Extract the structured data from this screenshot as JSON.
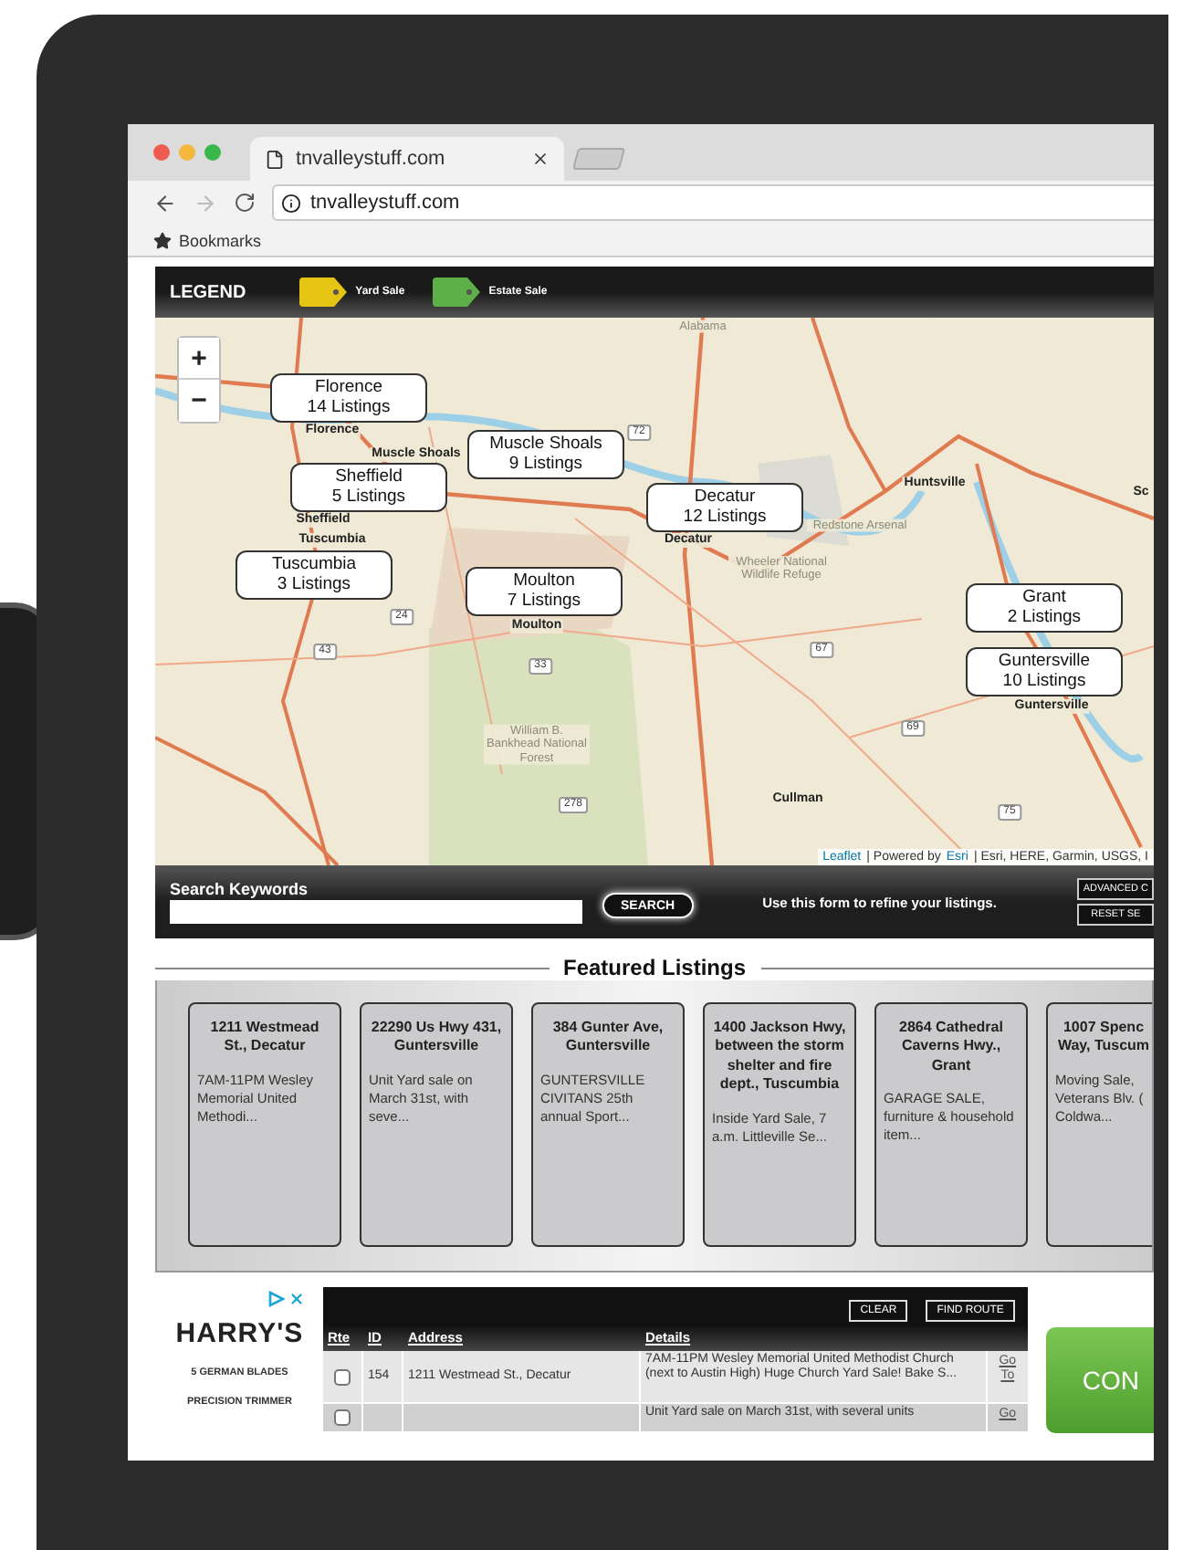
{
  "browser": {
    "tab_title": "tnvalleystuff.com",
    "address": "tnvalleystuff.com",
    "bookmarks": "Bookmarks"
  },
  "legend": {
    "title": "LEGEND",
    "items": [
      {
        "label": "Yard Sale",
        "color": "#e6c414"
      },
      {
        "label": "Estate Sale",
        "color": "#5daf48"
      }
    ]
  },
  "map": {
    "zoom_in": "+",
    "zoom_out": "−",
    "markers": [
      {
        "city": "Florence",
        "count": "14 Listings"
      },
      {
        "city": "Muscle Shoals",
        "count": "9 Listings"
      },
      {
        "city": "Sheffield",
        "count": "5 Listings"
      },
      {
        "city": "Decatur",
        "count": "12 Listings"
      },
      {
        "city": "Tuscumbia",
        "count": "3 Listings"
      },
      {
        "city": "Moulton",
        "count": "7 Listings"
      },
      {
        "city": "Grant",
        "count": "2 Listings"
      },
      {
        "city": "Guntersville",
        "count": "10 Listings"
      }
    ],
    "labels": [
      {
        "text": "Alabama",
        "kind": "area"
      },
      {
        "text": "Florence",
        "kind": "city"
      },
      {
        "text": "Muscle Shoals",
        "kind": "city"
      },
      {
        "text": "Sheffield",
        "kind": "city"
      },
      {
        "text": "Tuscumbia",
        "kind": "city"
      },
      {
        "text": "Decatur",
        "kind": "city"
      },
      {
        "text": "Huntsville",
        "kind": "city"
      },
      {
        "text": "Redstone Arsenal",
        "kind": "area"
      },
      {
        "text": "Wheeler National Wildlife Refuge",
        "kind": "area"
      },
      {
        "text": "Moulton",
        "kind": "city"
      },
      {
        "text": "William B. Bankhead National Forest",
        "kind": "area"
      },
      {
        "text": "Cullman",
        "kind": "city"
      },
      {
        "text": "Guntersville",
        "kind": "city"
      },
      {
        "text": "Sc",
        "kind": "city"
      },
      {
        "text": "72",
        "kind": "shield"
      },
      {
        "text": "24",
        "kind": "shield"
      },
      {
        "text": "43",
        "kind": "shield"
      },
      {
        "text": "33",
        "kind": "shield"
      },
      {
        "text": "67",
        "kind": "shield"
      },
      {
        "text": "69",
        "kind": "shield"
      },
      {
        "text": "278",
        "kind": "shield"
      },
      {
        "text": "75",
        "kind": "shield"
      }
    ],
    "attribution": {
      "leaflet": "Leaflet",
      "powered": "| Powered by",
      "esri": "Esri",
      "sources": "| Esri, HERE, Garmin, USGS, I"
    }
  },
  "search": {
    "label": "Search Keywords",
    "button": "SEARCH",
    "hint": "Use this form to refine your listings.",
    "side_buttons": [
      "ADVANCED C",
      "RESET SE"
    ]
  },
  "featured": {
    "title": "Featured Listings",
    "cards": [
      {
        "address": "1211 Westmead St., Decatur",
        "details": "7AM-11PM Wesley Memorial United Methodi..."
      },
      {
        "address": "22290 Us Hwy 431, Guntersville",
        "details": "Unit Yard sale on March 31st, with seve..."
      },
      {
        "address": "384 Gunter Ave, Guntersville",
        "details": "GUNTERSVILLE CIVITANS 25th annual Sport..."
      },
      {
        "address": "1400 Jackson Hwy, between the storm shelter and fire dept., Tuscumbia",
        "details": "Inside Yard Sale, 7 a.m. Littleville Se..."
      },
      {
        "address": "2864 Cathedral Caverns Hwy., Grant",
        "details": "GARAGE SALE, furniture & household item..."
      },
      {
        "address": "1007 Spenc Way, Tuscum",
        "details": "Moving Sale, Veterans Blv. ( Coldwa..."
      }
    ]
  },
  "ad": {
    "brand": "HARRY'S",
    "tagline": "5 GERMAN BLADES",
    "line": "PRECISION TRIMMER",
    "cta": "CON"
  },
  "route_table": {
    "buttons": [
      "CLEAR",
      "FIND ROUTE"
    ],
    "columns": [
      "Rte",
      "ID",
      "Address",
      "Details"
    ],
    "rows": [
      {
        "checked": false,
        "id": "154",
        "address": "1211 Westmead St., Decatur",
        "details": "7AM-11PM Wesley Memorial United Methodist Church (next to Austin High) Huge Church Yard Sale! Bake S...",
        "link": "Go To"
      },
      {
        "checked": false,
        "details": "Unit Yard sale on March 31st, with several units",
        "link": "Go"
      }
    ]
  }
}
